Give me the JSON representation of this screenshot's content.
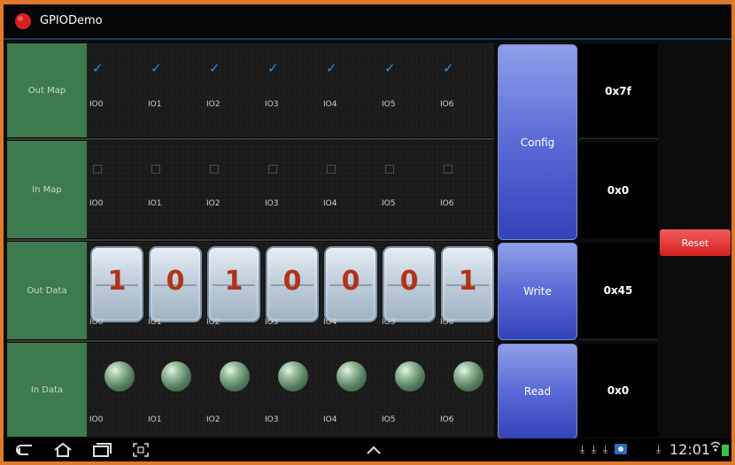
{
  "app": {
    "title": "GPIODemo",
    "icon": "app-record-icon"
  },
  "rows": [
    {
      "label": "Out Map"
    },
    {
      "label": "In Map"
    },
    {
      "label": "Out Data"
    },
    {
      "label": "In Data"
    }
  ],
  "io_labels": [
    "IO0",
    "IO1",
    "IO2",
    "IO3",
    "IO4",
    "IO5",
    "IO6"
  ],
  "out_map": [
    true,
    true,
    true,
    true,
    true,
    true,
    true
  ],
  "in_map": [
    false,
    false,
    false,
    false,
    false,
    false,
    false
  ],
  "out_data": [
    "1",
    "0",
    "1",
    "0",
    "0",
    "0",
    "1"
  ],
  "in_data_indicators": 7,
  "buttons": {
    "config": "Config",
    "write": "Write",
    "read": "Read",
    "reset": "Reset"
  },
  "values": {
    "out_map": "0x7f",
    "in_map": "0x0",
    "out_data": "0x45",
    "in_data": "0x0"
  },
  "status_bar": {
    "time": "12:01"
  },
  "colors": {
    "row_label_bg": "#3d7a4d",
    "button_blue": "#4a5ad0",
    "reset_red": "#e03a3a",
    "digit_red": "#b3321a",
    "checkbox_blue": "#2f8fe0"
  }
}
